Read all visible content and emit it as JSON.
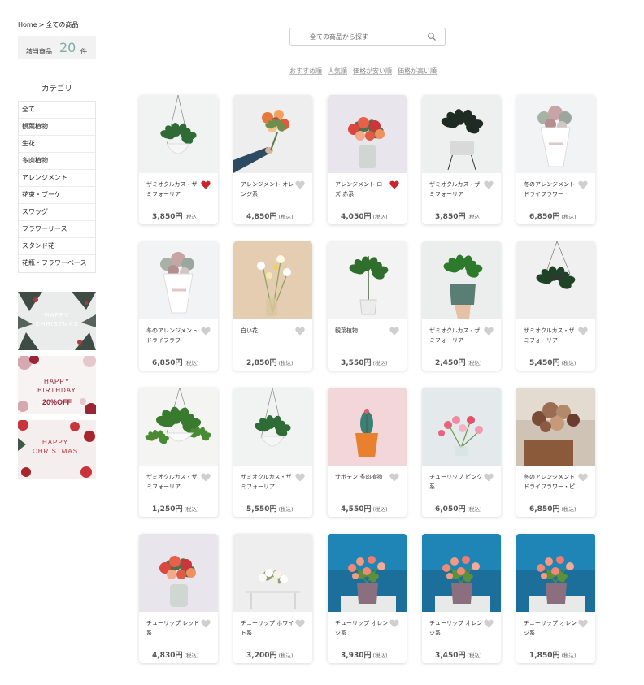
{
  "breadcrumb": {
    "home": "Home",
    "separator": ">",
    "current": "全ての商品"
  },
  "count": {
    "label": "該当商品",
    "value": "20",
    "unit": "件"
  },
  "categories": {
    "title": "カテゴリ",
    "items": [
      "全て",
      "観葉植物",
      "生花",
      "多肉植物",
      "アレンジメント",
      "花束・ブーケ",
      "スワッグ",
      "フラワーリース",
      "スタンド花",
      "花瓶・フラワーベース"
    ]
  },
  "banners": [
    {
      "line1": "HAPPY",
      "line2": "CHRISTMAS",
      "colors": [
        "#3f4b45",
        "#e9ecea"
      ]
    },
    {
      "line1": "HAPPY",
      "line2": "BIRTHDAY",
      "line3": "20%OFF",
      "colors": [
        "#9a2535",
        "#f7f3f3"
      ]
    },
    {
      "line1": "HAPPY",
      "line2": "CHRISTMAS",
      "colors": [
        "#c8343a",
        "#f4efee"
      ]
    }
  ],
  "search": {
    "placeholder": "全ての商品から探す",
    "value": ""
  },
  "sort": {
    "options": [
      "おすすめ順",
      "人気順",
      "価格が安い順",
      "価格が高い順"
    ]
  },
  "products": [
    {
      "name": "ザミオクルカス・ザミフォーリア",
      "price": "3,850円",
      "tax": "(税込)",
      "favorite": true,
      "image": "hanging-pot-plant"
    },
    {
      "name": "アレンジメント オレンジ系",
      "price": "4,850円",
      "tax": "(税込)",
      "favorite": false,
      "image": "hand-bouquet"
    },
    {
      "name": "アレンジメント ローズ 赤系",
      "price": "4,050円",
      "tax": "(税込)",
      "favorite": true,
      "image": "vase-roses"
    },
    {
      "name": "ザミオクルカス・ザミフォーリア",
      "price": "3,850円",
      "tax": "(税込)",
      "favorite": false,
      "image": "rubber-plant-stand"
    },
    {
      "name": "冬のアレンジメント ドライフラワー",
      "price": "6,850円",
      "tax": "(税込)",
      "favorite": false,
      "image": "dried-bouquet-white"
    },
    {
      "name": "冬のアレンジメント ドライフラワー",
      "price": "6,850円",
      "tax": "(税込)",
      "favorite": false,
      "image": "dried-bouquet-white"
    },
    {
      "name": "白い花",
      "price": "2,850円",
      "tax": "(税込)",
      "favorite": false,
      "image": "white-flowers-vase"
    },
    {
      "name": "観葉植物",
      "price": "3,550円",
      "tax": "(税込)",
      "favorite": false,
      "image": "foliage-plant"
    },
    {
      "name": "ザミオクルカス・ザミフォーリア",
      "price": "2,450円",
      "tax": "(税込)",
      "favorite": false,
      "image": "zz-plant-hand"
    },
    {
      "name": "ザミオクルカス・ザミフォーリア",
      "price": "5,450円",
      "tax": "(税込)",
      "favorite": false,
      "image": "hanging-ivy"
    },
    {
      "name": "ザミオクルカス・ザミフォーリア",
      "price": "1,250円",
      "tax": "(税込)",
      "favorite": false,
      "image": "hanging-pot-large"
    },
    {
      "name": "ザミオクルカス・ザミフォーリア",
      "price": "5,550円",
      "tax": "(税込)",
      "favorite": false,
      "image": "hanging-pot-plant"
    },
    {
      "name": "サボテン 多肉植物",
      "price": "4,550円",
      "tax": "(税込)",
      "favorite": false,
      "image": "cactus-pink"
    },
    {
      "name": "チューリップ ピンク系",
      "price": "6,050円",
      "tax": "(税込)",
      "favorite": false,
      "image": "pink-tulips"
    },
    {
      "name": "冬のアレンジメント ドライフラワー・ピ",
      "price": "6,850円",
      "tax": "(税込)",
      "favorite": false,
      "image": "dried-bouquet-brown"
    },
    {
      "name": "チューリップ レッド系",
      "price": "4,830円",
      "tax": "(税込)",
      "favorite": false,
      "image": "vase-roses"
    },
    {
      "name": "チューリップ ホワイト系",
      "price": "3,200円",
      "tax": "(税込)",
      "favorite": false,
      "image": "white-roses-table"
    },
    {
      "name": "チューリップ オレンジ系",
      "price": "3,930円",
      "tax": "(税込)",
      "favorite": false,
      "image": "orange-tulips-blue"
    },
    {
      "name": "チューリップ オレンジ系",
      "price": "3,450円",
      "tax": "(税込)",
      "favorite": false,
      "image": "orange-tulips-blue"
    },
    {
      "name": "チューリップ オレンジ系",
      "price": "1,850円",
      "tax": "(税込)",
      "favorite": false,
      "image": "orange-tulips-blue"
    }
  ],
  "colors": {
    "accent": "#7bb0a3",
    "heart_active": "#c8262c",
    "heart_inactive": "#cfcfcf"
  }
}
